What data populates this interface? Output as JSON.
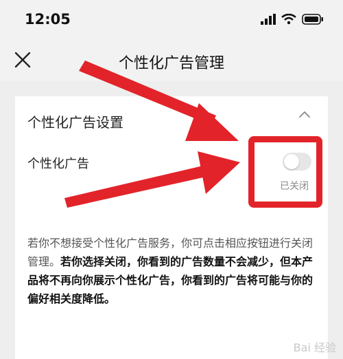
{
  "status_bar": {
    "time": "12:05"
  },
  "nav": {
    "title": "个性化广告管理"
  },
  "section": {
    "title": "个性化广告设置",
    "row_label": "个性化广告",
    "toggle_status": "已关闭",
    "toggle_on": false
  },
  "description": {
    "normal": "若你不想接受个性化广告服务，你可点击相应按钮进行关闭管理。",
    "bold": "若你选择关闭，你看到的广告数量不会减少，但本产品将不再向你展示个性化广告，你看到的广告将可能与你的偏好相关度降低。"
  },
  "watermark": {
    "text": "Bai 经验"
  },
  "colors": {
    "highlight": "#e2232a",
    "arrow": "#e2232a",
    "background": "#eeeeee"
  }
}
